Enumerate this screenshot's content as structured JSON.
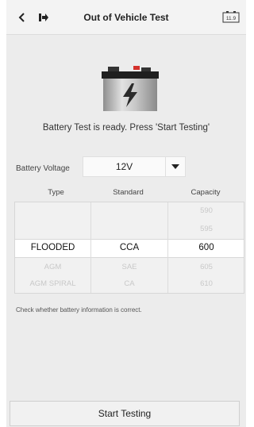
{
  "header": {
    "title": "Out of Vehicle Test",
    "battery_indicator": "11.9"
  },
  "ready_message": "Battery Test is ready. Press 'Start Testing'",
  "voltage": {
    "label": "Battery Voltage",
    "value": "12V"
  },
  "columns": {
    "type": "Type",
    "standard": "Standard",
    "capacity": "Capacity"
  },
  "picker": {
    "type": [
      "",
      "",
      "FLOODED",
      "AGM",
      "AGM SPIRAL"
    ],
    "standard": [
      "",
      "",
      "CCA",
      "SAE",
      "CA"
    ],
    "capacity": [
      "590",
      "595",
      "600",
      "605",
      "610"
    ]
  },
  "hint": "Check whether battery information is correct.",
  "start_button": "Start Testing"
}
